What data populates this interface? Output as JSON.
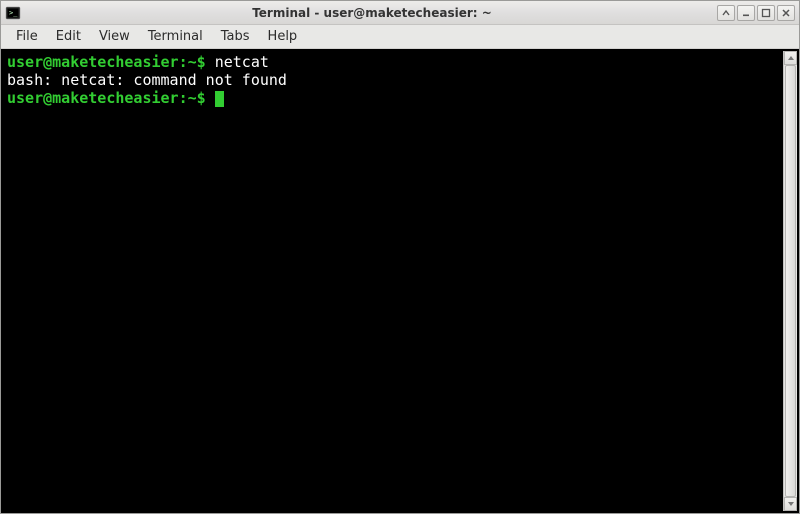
{
  "window": {
    "title": "Terminal - user@maketecheasier: ~"
  },
  "menu": {
    "items": [
      "File",
      "Edit",
      "View",
      "Terminal",
      "Tabs",
      "Help"
    ]
  },
  "terminal": {
    "lines": [
      {
        "prompt": "user@maketecheasier:~$",
        "command": " netcat"
      },
      {
        "output": "bash: netcat: command not found"
      },
      {
        "prompt": "user@maketecheasier:~$",
        "command": " ",
        "cursor": true
      }
    ]
  },
  "colors": {
    "prompt": "#32cd32",
    "terminal_bg": "#000000",
    "terminal_fg": "#ffffff",
    "cursor": "#32cd32"
  }
}
